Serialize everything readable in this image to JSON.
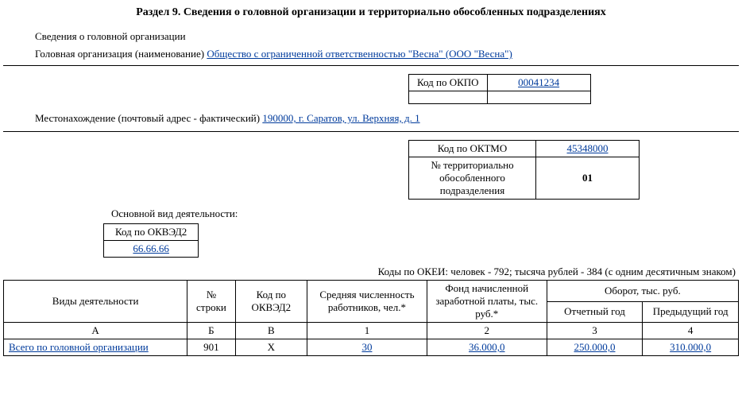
{
  "title": "Раздел 9. Сведения о головной организации и территориально обособленных подразделениях",
  "org_section_label": "Сведения о головной организации",
  "org_name_label": "Головная организация (наименование) ",
  "org_name_value": "Общество с ограниченной ответственностью \"Весна\" (ООО \"Весна\")",
  "okpo": {
    "label": "Код по ОКПО",
    "value": "00041234"
  },
  "address_label": "Местонахождение (почтовый адрес - фактический) ",
  "address_value": "190000, г. Саратов, ул. Верхняя, д. 1",
  "oktmo": {
    "label": "Код по ОКТМО",
    "value": "45348000"
  },
  "subdivision": {
    "label": "№ территориально обособленного подразделения",
    "value": "01"
  },
  "activity_main_label": "Основной вид деятельности:",
  "okved": {
    "label": "Код по ОКВЭД2",
    "value": "66.66.66"
  },
  "okei_note": "Коды по ОКЕИ: человек - 792; тысяча рублей - 384 (с одним десятичным знаком)",
  "table": {
    "headers": {
      "activity": "Виды деятельности",
      "row_no": "№ строки",
      "okved_code": "Код по ОКВЭД2",
      "avg_count": "Средняя численность работников, чел.*",
      "payroll": "Фонд начисленной заработной платы, тыс. руб.*",
      "turnover": "Оборот, тыс. руб.",
      "report_year": "Отчетный год",
      "prev_year": "Предыдущий год"
    },
    "subheader": {
      "a": "А",
      "b": "Б",
      "v": "В",
      "c1": "1",
      "c2": "2",
      "c3": "3",
      "c4": "4"
    },
    "rows": [
      {
        "activity": "Всего по головной организации",
        "row_no": "901",
        "okved_code": "Х",
        "avg_count": "30",
        "payroll": "36.000,0",
        "turnover_report": "250.000,0",
        "turnover_prev": "310.000,0"
      }
    ]
  }
}
